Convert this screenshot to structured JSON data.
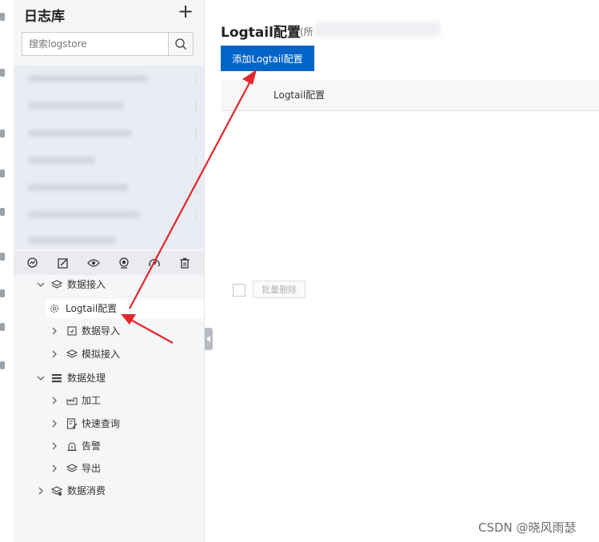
{
  "sidebar": {
    "title": "日志库",
    "add_icon": "plus-icon",
    "search": {
      "placeholder": "搜索logstore",
      "icon": "search-icon"
    }
  },
  "toolbar_icons": [
    "query-icon",
    "edit-icon",
    "view-icon",
    "monitor-icon",
    "dashboard-icon",
    "delete-icon"
  ],
  "tree": {
    "data_ingestion": {
      "label": "数据接入",
      "children": {
        "logtail_config": "Logtail配置",
        "data_import": "数据导入",
        "simulated_ingestion": "模拟接入"
      }
    },
    "data_processing": {
      "label": "数据处理",
      "children": {
        "transform": "加工",
        "quick_query": "快速查询",
        "alert": "告警",
        "export": "导出"
      }
    },
    "data_consumption": {
      "label": "数据消费"
    }
  },
  "main": {
    "title": "Logtail配置",
    "subtitle_prefix": "(所",
    "add_button": "添加Logtail配置",
    "table_header": "Logtail配置",
    "bulk_delete": "批量删除"
  },
  "watermark": "CSDN @晓风雨瑟",
  "colors": {
    "primary": "#0064c8",
    "annotation_arrow": "#e3262b",
    "panel_bg": "#f5f6f8"
  }
}
